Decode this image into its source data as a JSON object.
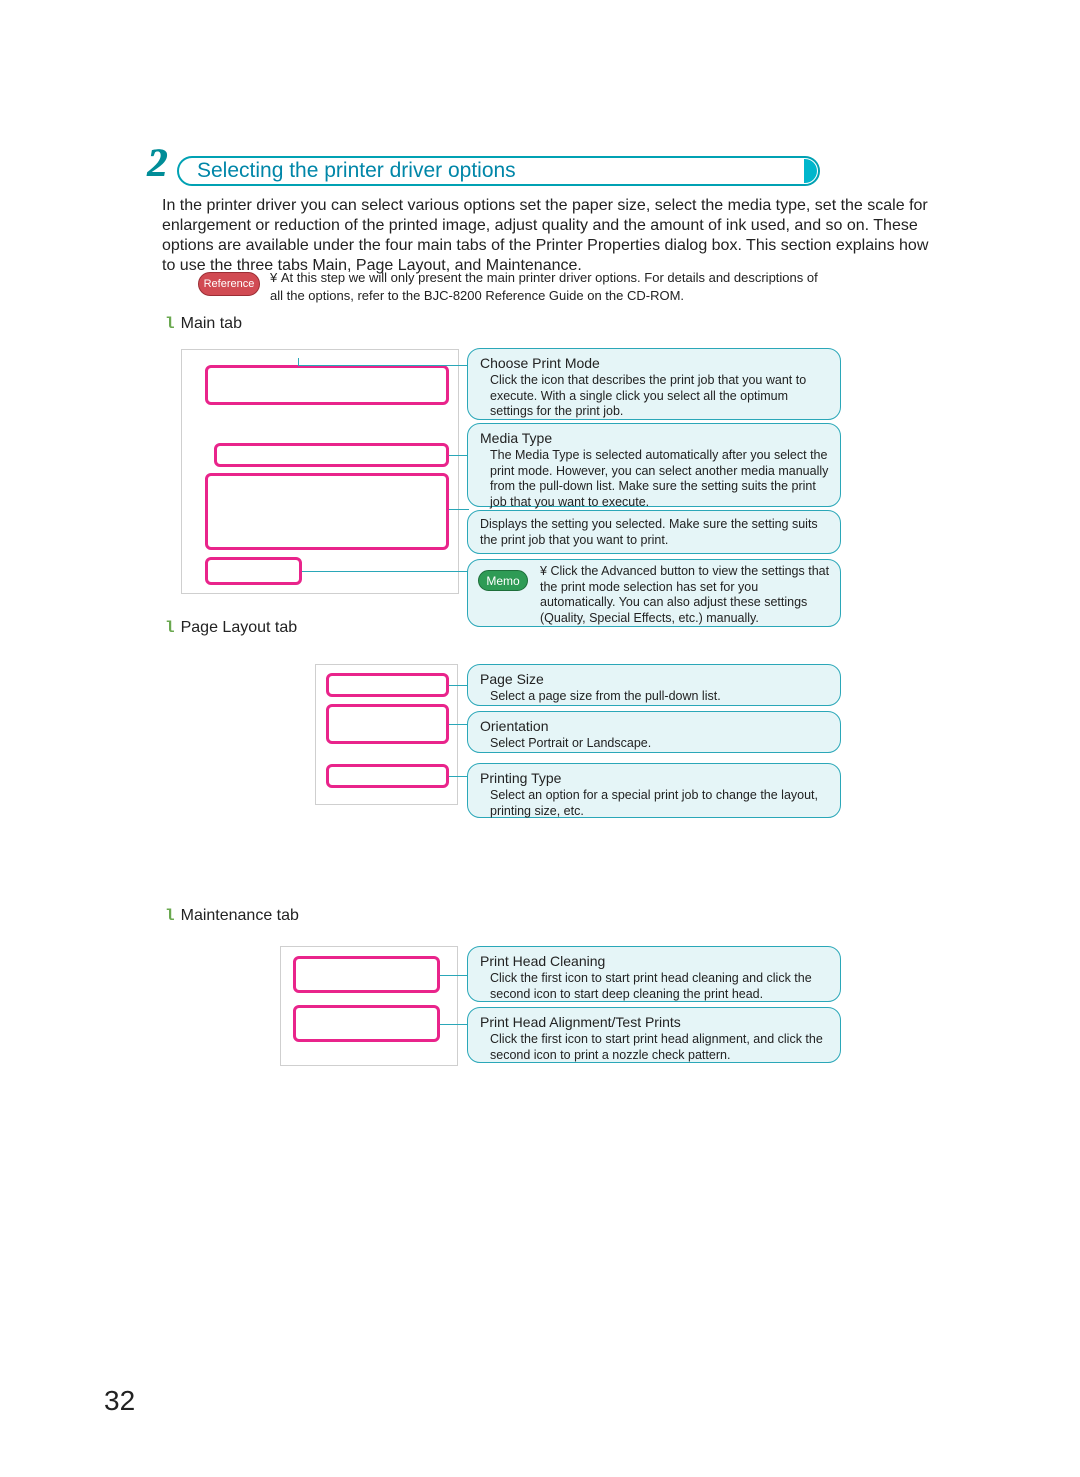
{
  "step_number": "2",
  "heading": "Selecting the printer driver options",
  "intro": "In the printer driver you can select various options set the paper size, select the media type, set the scale for enlargement or reduction of the printed image, adjust quality and the amount of ink used, and so on. These options are available under the four main tabs of the Printer Properties dialog box. This section explains how to use the three tabs Main, Page Layout, and Maintenance.",
  "reference": {
    "badge": "Reference",
    "text": "At this step we will only present the main printer driver options. For details and descriptions of all the options, refer to the  BJC-8200 Reference Guide  on the CD-ROM."
  },
  "sections": {
    "main": {
      "bullet": "l",
      "label": "Main tab"
    },
    "pagelayout": {
      "bullet": "l",
      "label": "Page Layout tab"
    },
    "maintenance": {
      "bullet": "l",
      "label": "Maintenance tab"
    }
  },
  "callouts": {
    "choose_print_mode": {
      "title": "Choose Print Mode",
      "desc": "Click the icon that describes the print job that you want to execute. With a single click you select all the optimum settings for the print job."
    },
    "media_type": {
      "title": "Media Type",
      "desc": "The Media Type is selected automatically after you select the print mode. However, you can select another media manually from the pull-down list. Make sure the setting suits the print job that you want to execute."
    },
    "display_setting": {
      "desc": "Displays the setting you selected. Make sure the setting suits the print job that you want to print."
    },
    "advanced_memo": {
      "memo": "Memo",
      "desc": "Click the Advanced button to view the settings that the print mode selection has set for you automatically. You can also adjust these settings (Quality, Special Effects, etc.) manually."
    },
    "page_size": {
      "title": "Page Size",
      "desc": "Select a page size from the pull-down list."
    },
    "orientation": {
      "title": "Orientation",
      "desc": "Select Portrait or Landscape."
    },
    "printing_type": {
      "title": "Printing Type",
      "desc": "Select an option for a special print job to change the layout, printing size, etc."
    },
    "print_head_cleaning": {
      "title": "Print Head Cleaning",
      "desc": "Click the first icon to start print head cleaning and click the second icon to start deep cleaning the print head."
    },
    "print_head_alignment": {
      "title": "Print Head Alignment/Test Prints",
      "desc": "Click the first icon to start print head alignment, and click the second icon to print a nozzle check pattern."
    }
  },
  "page_number": "32"
}
